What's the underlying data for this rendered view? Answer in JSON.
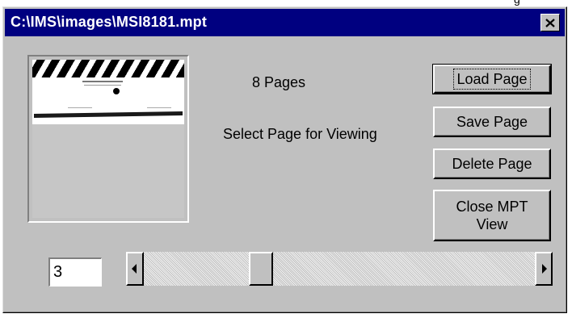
{
  "corner_text": "g",
  "window": {
    "title": "C:\\IMS\\images\\MSI8181.mpt",
    "close_icon": "close-x-icon"
  },
  "info": {
    "pages_label": "8 Pages",
    "select_label": "Select Page for Viewing"
  },
  "buttons": {
    "load": "Load Page",
    "save": "Save Page",
    "delete": "Delete Page",
    "close": "Close MPT View"
  },
  "page_input": {
    "value": "3"
  },
  "scrollbar": {
    "min": 1,
    "max": 8,
    "value": 3
  },
  "colors": {
    "title_bar": "#000080",
    "face": "#c0c0c0"
  }
}
